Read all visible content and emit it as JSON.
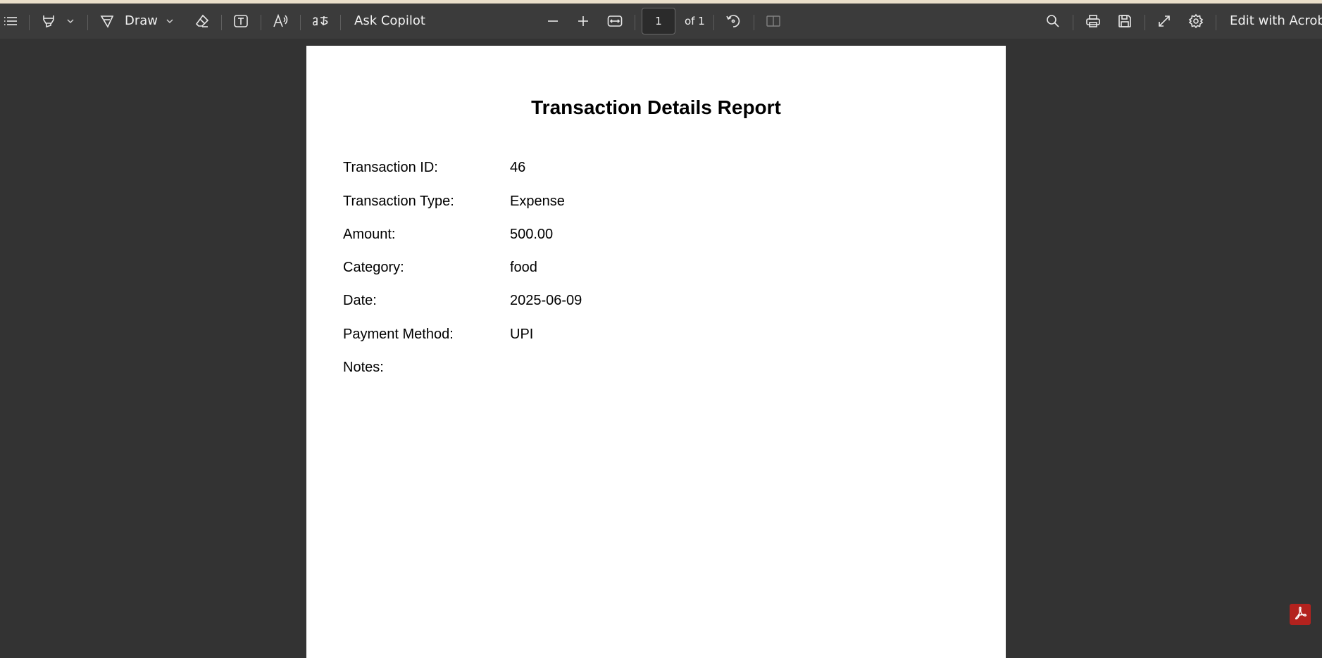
{
  "toolbar": {
    "draw_label": "Draw",
    "ask_copilot_label": "Ask Copilot",
    "page_current": "1",
    "page_total": "of 1",
    "edit_acrobat_label": "Edit with Acrobat"
  },
  "icons": {
    "contents": "list-icon",
    "highlight": "highlighter-icon",
    "draw": "pen-icon",
    "erase": "eraser-icon",
    "text": "text-box-icon",
    "read_aloud": "read-aloud-icon",
    "translate": "translate-icon",
    "zoom_out": "minus-icon",
    "zoom_in": "plus-icon",
    "fit": "fit-width-icon",
    "rotate": "rotate-icon",
    "two_page": "page-view-icon",
    "search": "search-icon",
    "print": "print-icon",
    "save": "save-icon",
    "fullscreen": "expand-icon",
    "settings": "gear-icon",
    "acrobat": "acrobat-icon"
  },
  "colors": {
    "toolbar_bg": "#3b3b3b",
    "viewer_bg": "#333333",
    "acrobat_red": "#b3221e"
  },
  "document": {
    "title": "Transaction Details Report",
    "fields": [
      {
        "label": "Transaction ID:",
        "value": "46"
      },
      {
        "label": "Transaction Type:",
        "value": "Expense"
      },
      {
        "label": "Amount:",
        "value": "500.00"
      },
      {
        "label": "Category:",
        "value": "food"
      },
      {
        "label": "Date:",
        "value": "2025-06-09"
      },
      {
        "label": "Payment Method:",
        "value": "UPI"
      },
      {
        "label": "Notes:",
        "value": ""
      }
    ]
  }
}
